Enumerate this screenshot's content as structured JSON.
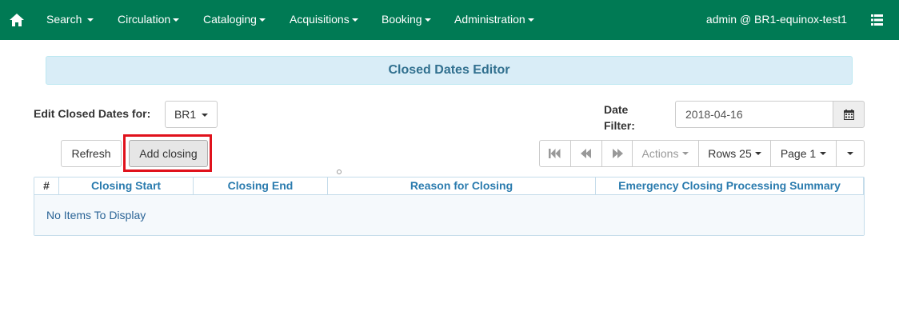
{
  "navbar": {
    "home_icon": "home-icon",
    "items": [
      {
        "label": "Search"
      },
      {
        "label": "Circulation"
      },
      {
        "label": "Cataloging"
      },
      {
        "label": "Acquisitions"
      },
      {
        "label": "Booking"
      },
      {
        "label": "Administration"
      }
    ],
    "user": "admin @ BR1-equinox-test1",
    "menu_icon": "list-icon",
    "bg_color": "#007a54"
  },
  "page": {
    "title": "Closed Dates Editor"
  },
  "filters": {
    "edit_label": "Edit Closed Dates for:",
    "org_value": "BR1",
    "date_filter_label_line1": "Date",
    "date_filter_label_line2": "Filter:",
    "date_value": "2018-04-16"
  },
  "actions": {
    "refresh": "Refresh",
    "add_closing": "Add closing"
  },
  "pager": {
    "actions": "Actions",
    "rows": "Rows 25",
    "page": "Page 1"
  },
  "grid": {
    "columns": [
      "#",
      "Closing Start",
      "Closing End",
      "Reason for Closing",
      "Emergency Closing Processing Summary"
    ],
    "empty_message": "No Items To Display"
  },
  "colors": {
    "highlight": "#e0121c",
    "title_banner": "#d9edf7",
    "link": "#2a7bae"
  }
}
